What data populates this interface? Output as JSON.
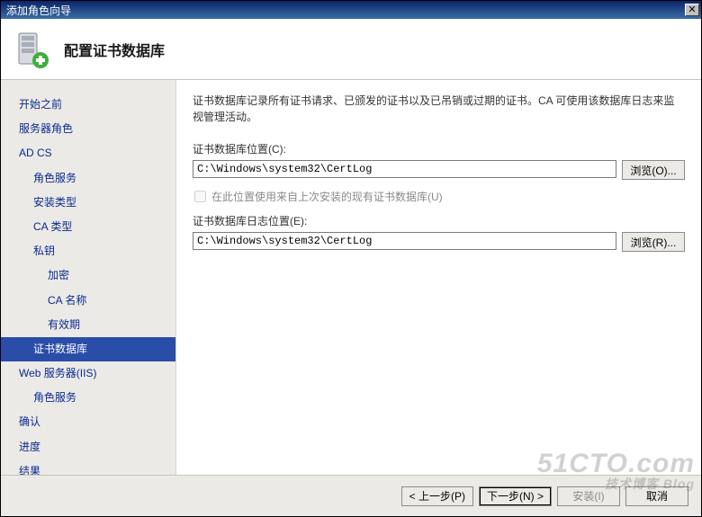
{
  "window": {
    "title": "添加角色向导"
  },
  "header": {
    "title": "配置证书数据库"
  },
  "sidebar": {
    "items": [
      {
        "label": "开始之前",
        "indent": 0
      },
      {
        "label": "服务器角色",
        "indent": 0
      },
      {
        "label": "AD CS",
        "indent": 0
      },
      {
        "label": "角色服务",
        "indent": 1
      },
      {
        "label": "安装类型",
        "indent": 1
      },
      {
        "label": "CA 类型",
        "indent": 1
      },
      {
        "label": "私钥",
        "indent": 1
      },
      {
        "label": "加密",
        "indent": 2
      },
      {
        "label": "CA 名称",
        "indent": 2
      },
      {
        "label": "有效期",
        "indent": 2
      },
      {
        "label": "证书数据库",
        "indent": 1,
        "selected": true
      },
      {
        "label": "Web 服务器(IIS)",
        "indent": 0
      },
      {
        "label": "角色服务",
        "indent": 1
      },
      {
        "label": "确认",
        "indent": 0
      },
      {
        "label": "进度",
        "indent": 0
      },
      {
        "label": "结果",
        "indent": 0
      }
    ]
  },
  "main": {
    "intro": "证书数据库记录所有证书请求、已颁发的证书以及已吊销或过期的证书。CA 可使用该数据库日志来监视管理活动。",
    "db_location_label": "证书数据库位置(C):",
    "db_location_value": "C:\\Windows\\system32\\CertLog",
    "browse_db_label": "浏览(O)...",
    "reuse_checkbox_label": "在此位置使用来自上次安装的现有证书数据库(U)",
    "log_location_label": "证书数据库日志位置(E):",
    "log_location_value": "C:\\Windows\\system32\\CertLog",
    "browse_log_label": "浏览(R)..."
  },
  "footer": {
    "prev": "< 上一步(P)",
    "next": "下一步(N) >",
    "install": "安装(I)",
    "cancel": "取消"
  },
  "watermark": {
    "main": "51CTO.com",
    "sub": "技术博客    Blog"
  }
}
